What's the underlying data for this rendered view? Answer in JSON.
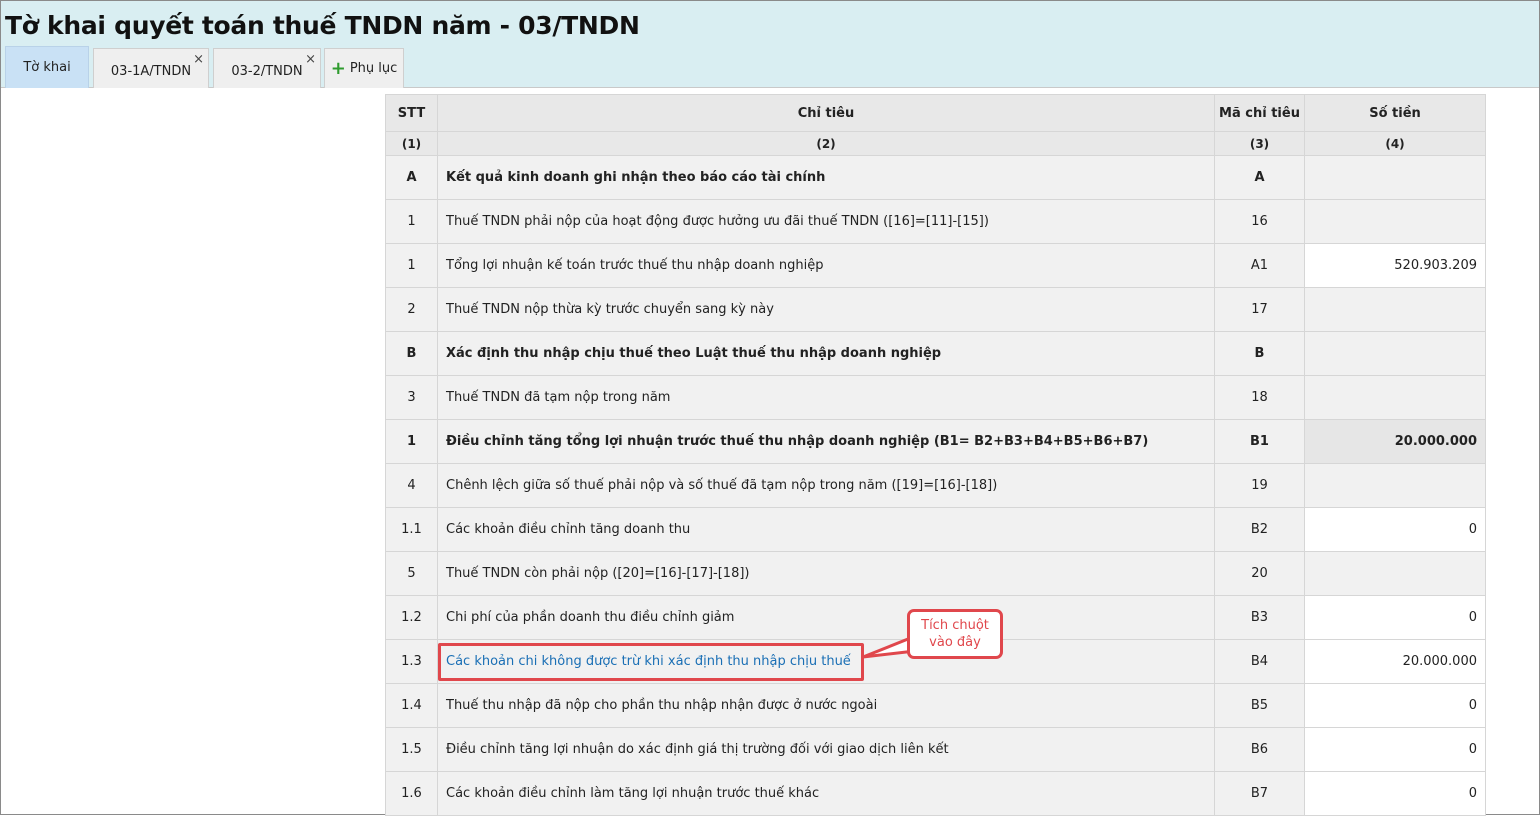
{
  "page_title": "Tờ khai quyết toán thuế TNDN năm - 03/TNDN",
  "tabs": [
    {
      "label": "Tờ khai"
    },
    {
      "label": "03-1A/TNDN",
      "close": "×"
    },
    {
      "label": "03-2/TNDN",
      "close": "×"
    },
    {
      "label": "Phụ lục",
      "icon": "plus-icon"
    }
  ],
  "table": {
    "headers": [
      "STT",
      "Chỉ tiêu",
      "Mã chỉ tiêu",
      "Số tiền"
    ],
    "subheaders": [
      "(1)",
      "(2)",
      "(3)",
      "(4)"
    ],
    "rows": [
      {
        "stt": "A",
        "label": "Kết quả kinh doanh ghi nhận theo báo cáo tài chính",
        "code": "A",
        "amount": ""
      },
      {
        "stt": "1",
        "label": "Thuế TNDN phải nộp của hoạt động được hưởng ưu đãi thuế TNDN ([16]=[11]-[15])",
        "code": "16",
        "amount": ""
      },
      {
        "stt": "1",
        "label": "Tổng lợi nhuận kế toán trước thuế thu nhập doanh nghiệp",
        "code": "A1",
        "amount": "520.903.209"
      },
      {
        "stt": "2",
        "label": "Thuế TNDN nộp thừa kỳ trước chuyển sang kỳ này",
        "code": "17",
        "amount": ""
      },
      {
        "stt": "B",
        "label": "Xác định thu nhập chịu thuế theo Luật thuế thu nhập doanh nghiệp",
        "code": "B",
        "amount": ""
      },
      {
        "stt": "3",
        "label": "Thuế TNDN đã tạm nộp trong năm",
        "code": "18",
        "amount": ""
      },
      {
        "stt": "1",
        "label": "Điều chỉnh tăng tổng lợi nhuận trước thuế thu nhập doanh nghiệp (B1= B2+B3+B4+B5+B6+B7)",
        "code": "B1",
        "amount": "20.000.000"
      },
      {
        "stt": "4",
        "label": "Chênh lệch giữa số thuế phải nộp và số thuế đã tạm nộp trong năm ([19]=[16]-[18])",
        "code": "19",
        "amount": ""
      },
      {
        "stt": "1.1",
        "label": "Các khoản điều chỉnh tăng doanh thu",
        "code": "B2",
        "amount": "0"
      },
      {
        "stt": "5",
        "label": "Thuế TNDN còn phải nộp ([20]=[16]-[17]-[18])",
        "code": "20",
        "amount": ""
      },
      {
        "stt": "1.2",
        "label": "Chi phí của phần doanh thu điều chỉnh giảm",
        "code": "B3",
        "amount": "0"
      },
      {
        "stt": "1.3",
        "label": "Các khoản chi không được trừ khi xác định thu nhập chịu thuế",
        "code": "B4",
        "amount": "20.000.000"
      },
      {
        "stt": "1.4",
        "label": "Thuế thu nhập đã nộp cho phần thu nhập nhận được ở nước ngoài",
        "code": "B5",
        "amount": "0"
      },
      {
        "stt": "1.5",
        "label": "Điều chỉnh tăng lợi nhuận do xác định giá thị trường đối với giao dịch liên kết",
        "code": "B6",
        "amount": "0"
      },
      {
        "stt": "1.6",
        "label": "Các khoản điều chỉnh làm tăng lợi nhuận trước thuế khác",
        "code": "B7",
        "amount": "0"
      }
    ]
  },
  "callout": {
    "line1": "Tích chuột",
    "line2": "vào đây"
  },
  "colors": {
    "header_bg": "#d9eef2",
    "active_tab": "#c9e1f5",
    "link": "#1a6fb5",
    "highlight": "#e0474c",
    "plus": "#2e9b2e"
  }
}
